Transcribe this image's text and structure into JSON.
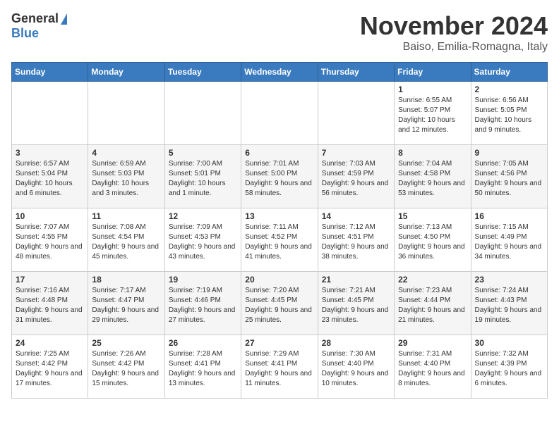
{
  "header": {
    "logo_general": "General",
    "logo_blue": "Blue",
    "title": "November 2024",
    "location": "Baiso, Emilia-Romagna, Italy"
  },
  "days_of_week": [
    "Sunday",
    "Monday",
    "Tuesday",
    "Wednesday",
    "Thursday",
    "Friday",
    "Saturday"
  ],
  "weeks": [
    [
      {
        "day": "",
        "info": ""
      },
      {
        "day": "",
        "info": ""
      },
      {
        "day": "",
        "info": ""
      },
      {
        "day": "",
        "info": ""
      },
      {
        "day": "",
        "info": ""
      },
      {
        "day": "1",
        "info": "Sunrise: 6:55 AM\nSunset: 5:07 PM\nDaylight: 10 hours and 12 minutes."
      },
      {
        "day": "2",
        "info": "Sunrise: 6:56 AM\nSunset: 5:05 PM\nDaylight: 10 hours and 9 minutes."
      }
    ],
    [
      {
        "day": "3",
        "info": "Sunrise: 6:57 AM\nSunset: 5:04 PM\nDaylight: 10 hours and 6 minutes."
      },
      {
        "day": "4",
        "info": "Sunrise: 6:59 AM\nSunset: 5:03 PM\nDaylight: 10 hours and 3 minutes."
      },
      {
        "day": "5",
        "info": "Sunrise: 7:00 AM\nSunset: 5:01 PM\nDaylight: 10 hours and 1 minute."
      },
      {
        "day": "6",
        "info": "Sunrise: 7:01 AM\nSunset: 5:00 PM\nDaylight: 9 hours and 58 minutes."
      },
      {
        "day": "7",
        "info": "Sunrise: 7:03 AM\nSunset: 4:59 PM\nDaylight: 9 hours and 56 minutes."
      },
      {
        "day": "8",
        "info": "Sunrise: 7:04 AM\nSunset: 4:58 PM\nDaylight: 9 hours and 53 minutes."
      },
      {
        "day": "9",
        "info": "Sunrise: 7:05 AM\nSunset: 4:56 PM\nDaylight: 9 hours and 50 minutes."
      }
    ],
    [
      {
        "day": "10",
        "info": "Sunrise: 7:07 AM\nSunset: 4:55 PM\nDaylight: 9 hours and 48 minutes."
      },
      {
        "day": "11",
        "info": "Sunrise: 7:08 AM\nSunset: 4:54 PM\nDaylight: 9 hours and 45 minutes."
      },
      {
        "day": "12",
        "info": "Sunrise: 7:09 AM\nSunset: 4:53 PM\nDaylight: 9 hours and 43 minutes."
      },
      {
        "day": "13",
        "info": "Sunrise: 7:11 AM\nSunset: 4:52 PM\nDaylight: 9 hours and 41 minutes."
      },
      {
        "day": "14",
        "info": "Sunrise: 7:12 AM\nSunset: 4:51 PM\nDaylight: 9 hours and 38 minutes."
      },
      {
        "day": "15",
        "info": "Sunrise: 7:13 AM\nSunset: 4:50 PM\nDaylight: 9 hours and 36 minutes."
      },
      {
        "day": "16",
        "info": "Sunrise: 7:15 AM\nSunset: 4:49 PM\nDaylight: 9 hours and 34 minutes."
      }
    ],
    [
      {
        "day": "17",
        "info": "Sunrise: 7:16 AM\nSunset: 4:48 PM\nDaylight: 9 hours and 31 minutes."
      },
      {
        "day": "18",
        "info": "Sunrise: 7:17 AM\nSunset: 4:47 PM\nDaylight: 9 hours and 29 minutes."
      },
      {
        "day": "19",
        "info": "Sunrise: 7:19 AM\nSunset: 4:46 PM\nDaylight: 9 hours and 27 minutes."
      },
      {
        "day": "20",
        "info": "Sunrise: 7:20 AM\nSunset: 4:45 PM\nDaylight: 9 hours and 25 minutes."
      },
      {
        "day": "21",
        "info": "Sunrise: 7:21 AM\nSunset: 4:45 PM\nDaylight: 9 hours and 23 minutes."
      },
      {
        "day": "22",
        "info": "Sunrise: 7:23 AM\nSunset: 4:44 PM\nDaylight: 9 hours and 21 minutes."
      },
      {
        "day": "23",
        "info": "Sunrise: 7:24 AM\nSunset: 4:43 PM\nDaylight: 9 hours and 19 minutes."
      }
    ],
    [
      {
        "day": "24",
        "info": "Sunrise: 7:25 AM\nSunset: 4:42 PM\nDaylight: 9 hours and 17 minutes."
      },
      {
        "day": "25",
        "info": "Sunrise: 7:26 AM\nSunset: 4:42 PM\nDaylight: 9 hours and 15 minutes."
      },
      {
        "day": "26",
        "info": "Sunrise: 7:28 AM\nSunset: 4:41 PM\nDaylight: 9 hours and 13 minutes."
      },
      {
        "day": "27",
        "info": "Sunrise: 7:29 AM\nSunset: 4:41 PM\nDaylight: 9 hours and 11 minutes."
      },
      {
        "day": "28",
        "info": "Sunrise: 7:30 AM\nSunset: 4:40 PM\nDaylight: 9 hours and 10 minutes."
      },
      {
        "day": "29",
        "info": "Sunrise: 7:31 AM\nSunset: 4:40 PM\nDaylight: 9 hours and 8 minutes."
      },
      {
        "day": "30",
        "info": "Sunrise: 7:32 AM\nSunset: 4:39 PM\nDaylight: 9 hours and 6 minutes."
      }
    ]
  ]
}
